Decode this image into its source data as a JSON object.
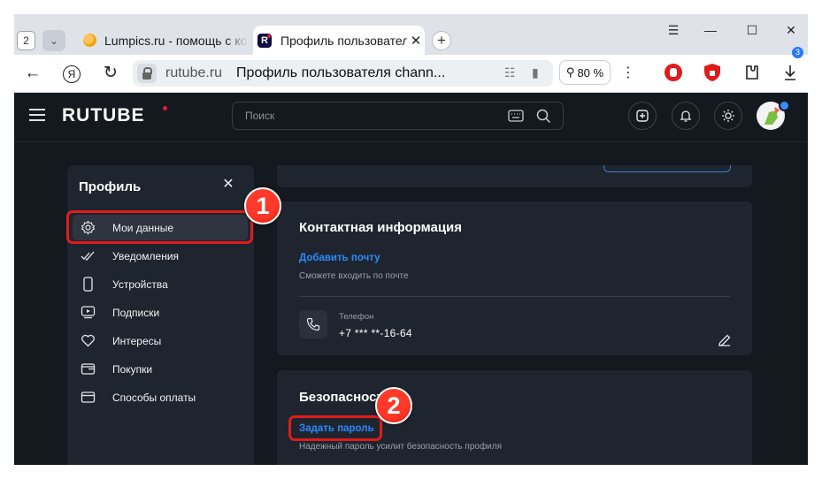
{
  "browser": {
    "tab_count": "2",
    "tabs": [
      {
        "title": "Lumpics.ru - помощь с компьютером"
      },
      {
        "title": "Профиль пользователя"
      }
    ],
    "address": {
      "domain": "rutube.ru",
      "page_title": "Профиль пользователя chann..."
    },
    "zoom": "80 %",
    "downloads_badge": "3"
  },
  "site": {
    "logo": "RUTUBE",
    "search_placeholder": "Поиск"
  },
  "sidebar": {
    "title": "Профиль",
    "items": [
      {
        "label": "Мои данные",
        "icon": "gear-icon"
      },
      {
        "label": "Уведомления",
        "icon": "double-check-icon"
      },
      {
        "label": "Устройства",
        "icon": "smartphone-icon"
      },
      {
        "label": "Подписки",
        "icon": "subscriptions-icon"
      },
      {
        "label": "Интересы",
        "icon": "heart-icon"
      },
      {
        "label": "Покупки",
        "icon": "wallet-icon"
      },
      {
        "label": "Способы оплаты",
        "icon": "card-icon"
      }
    ]
  },
  "contact": {
    "heading": "Контактная информация",
    "add_email_link": "Добавить почту",
    "add_email_hint": "Сможете входить по почте",
    "phone_label": "Телефон",
    "phone_value": "+7 *** **-16-64"
  },
  "security": {
    "heading": "Безопасность",
    "set_password_link": "Задать пароль",
    "set_password_hint": "Надежный пароль усилит безопасность профиля"
  },
  "annotations": [
    "1",
    "2"
  ],
  "colors": {
    "page_bg": "#14191f",
    "card_bg": "#1f252e",
    "link": "#2b8aff",
    "highlight": "#e01b1b",
    "brand_dot": "#ed143b"
  }
}
